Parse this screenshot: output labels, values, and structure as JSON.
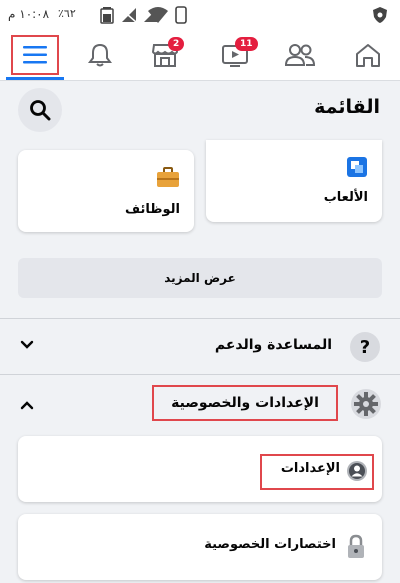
{
  "status_bar": {
    "time": "١٠:٠٨ م",
    "battery": "٪٦٢"
  },
  "nav": {
    "marketplace_badge": "2",
    "watch_badge": "11"
  },
  "menu": {
    "title": "القائمة",
    "shortcuts": [
      {
        "label": "الألعاب",
        "icon": "games-icon"
      },
      {
        "label": "الوظائف",
        "icon": "jobs-briefcase-icon"
      }
    ],
    "see_more": "عرض المزيد",
    "help_support": "المساعدة والدعم",
    "settings_privacy": "الإعدادات والخصوصية",
    "settings": "الإعدادات",
    "privacy_shortcuts": "اختصارات الخصوصية"
  },
  "colors": {
    "accent_blue": "#1877f2",
    "badge_red": "#e41e3f",
    "highlight_red": "#e0474c"
  }
}
